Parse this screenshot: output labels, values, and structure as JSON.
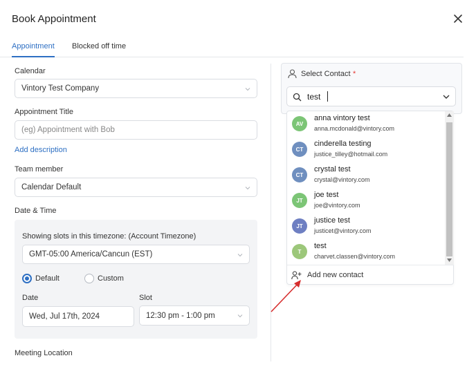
{
  "modal": {
    "title": "Book Appointment"
  },
  "tabs": [
    {
      "label": "Appointment",
      "active": true
    },
    {
      "label": "Blocked off time",
      "active": false
    }
  ],
  "form": {
    "calendar_label": "Calendar",
    "calendar_value": "Vintory Test Company",
    "title_label": "Appointment Title",
    "title_placeholder": "(eg) Appointment with Bob",
    "add_description": "Add description",
    "team_label": "Team member",
    "team_value": "Calendar Default",
    "datetime_label": "Date & Time",
    "timezone_note": "Showing slots in this timezone: (Account Timezone)",
    "timezone_value": "GMT-05:00 America/Cancun (EST)",
    "radio_default": "Default",
    "radio_custom": "Custom",
    "date_label": "Date",
    "date_value": "Wed, Jul 17th, 2024",
    "slot_label": "Slot",
    "slot_value": "12:30 pm - 1:00 pm",
    "meeting_location_label": "Meeting Location"
  },
  "contact": {
    "label": "Select Contact",
    "required_mark": "*",
    "search_value": "test",
    "results": [
      {
        "initials": "AV",
        "name": "anna vintory test",
        "email": "anna.mcdonald@vintory.com",
        "color": "#7cc576"
      },
      {
        "initials": "CT",
        "name": "cinderella testing",
        "email": "justice_tilley@hotmail.com",
        "color": "#6f8fbf"
      },
      {
        "initials": "CT",
        "name": "crystal test",
        "email": "crystal@vintory.com",
        "color": "#6f8fbf"
      },
      {
        "initials": "JT",
        "name": "joe test",
        "email": "joe@vintory.com",
        "color": "#7cc576"
      },
      {
        "initials": "JT",
        "name": "justice test",
        "email": "justicet@vintory.com",
        "color": "#6e7fc2"
      },
      {
        "initials": "T",
        "name": "test",
        "email": "charvet.classen@vintory.com",
        "color": "#9cc77a"
      }
    ],
    "add_new_label": "Add new contact"
  },
  "colors": {
    "accent": "#2d6fc3",
    "required": "#e53935",
    "arrow": "#d62d2d"
  }
}
